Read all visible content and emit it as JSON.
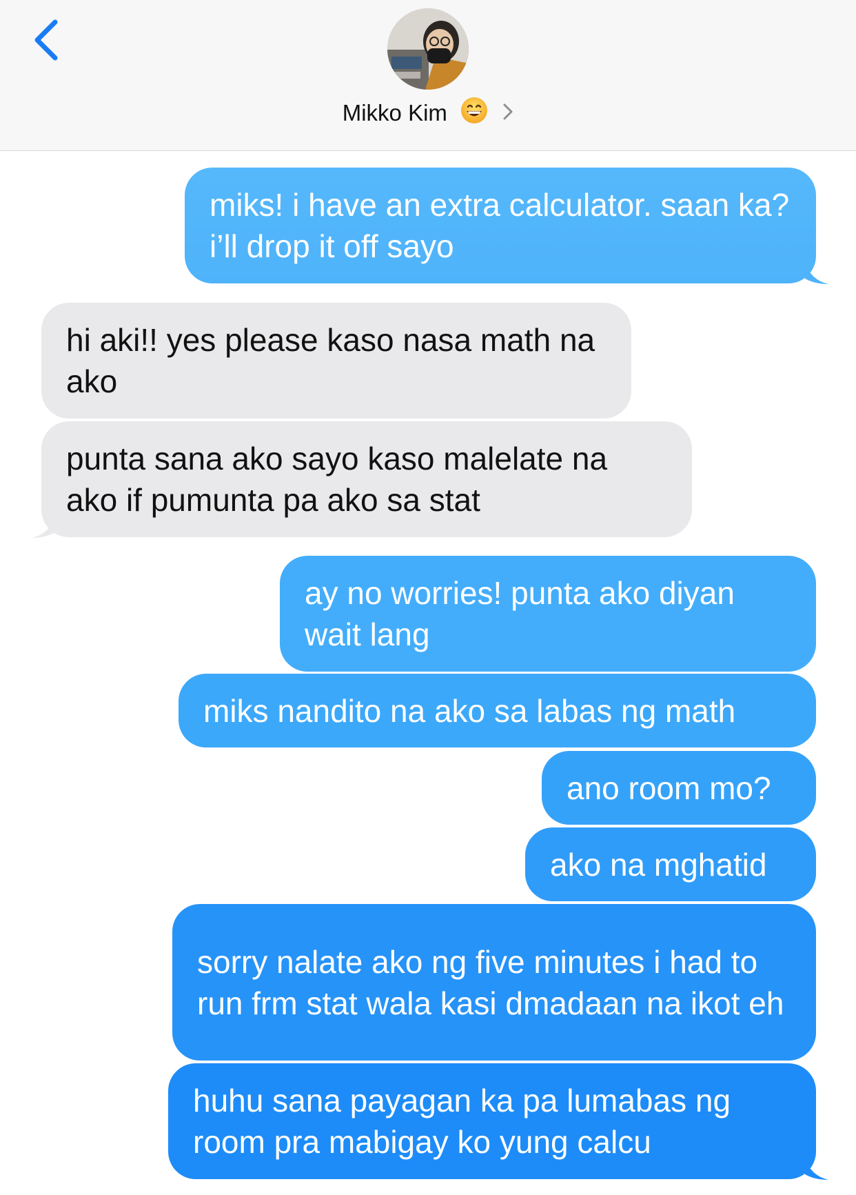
{
  "header": {
    "contact_name": "Mikko Kim"
  },
  "messages": [
    {
      "direction": "outgoing",
      "text": "miks! i have an extra calculator. saan ka? i’ll drop it off sayo"
    },
    {
      "direction": "incoming",
      "text": "hi aki!! yes please kaso nasa math na ako"
    },
    {
      "direction": "incoming",
      "text": "punta sana ako sayo kaso malelate na ako if pumunta pa ako sa stat"
    },
    {
      "direction": "outgoing",
      "text": "ay no worries! punta ako diyan wait lang"
    },
    {
      "direction": "outgoing",
      "text": "miks nandito na ako sa labas ng math"
    },
    {
      "direction": "outgoing",
      "text": "ano room mo?"
    },
    {
      "direction": "outgoing",
      "text": "ako na mghatid"
    },
    {
      "direction": "outgoing",
      "text": "sorry nalate ako ng five minutes i had to run frm stat wala kasi dmadaan na ikot eh"
    },
    {
      "direction": "outgoing",
      "text": "huhu sana payagan ka pa lumabas ng room pra mabigay ko yung calcu"
    }
  ],
  "colors": {
    "outgoing_top": "#52b6fb",
    "outgoing_bottom": "#1d8cf8",
    "incoming": "#e9e9eb",
    "ios_blue": "#1a7cf5"
  }
}
